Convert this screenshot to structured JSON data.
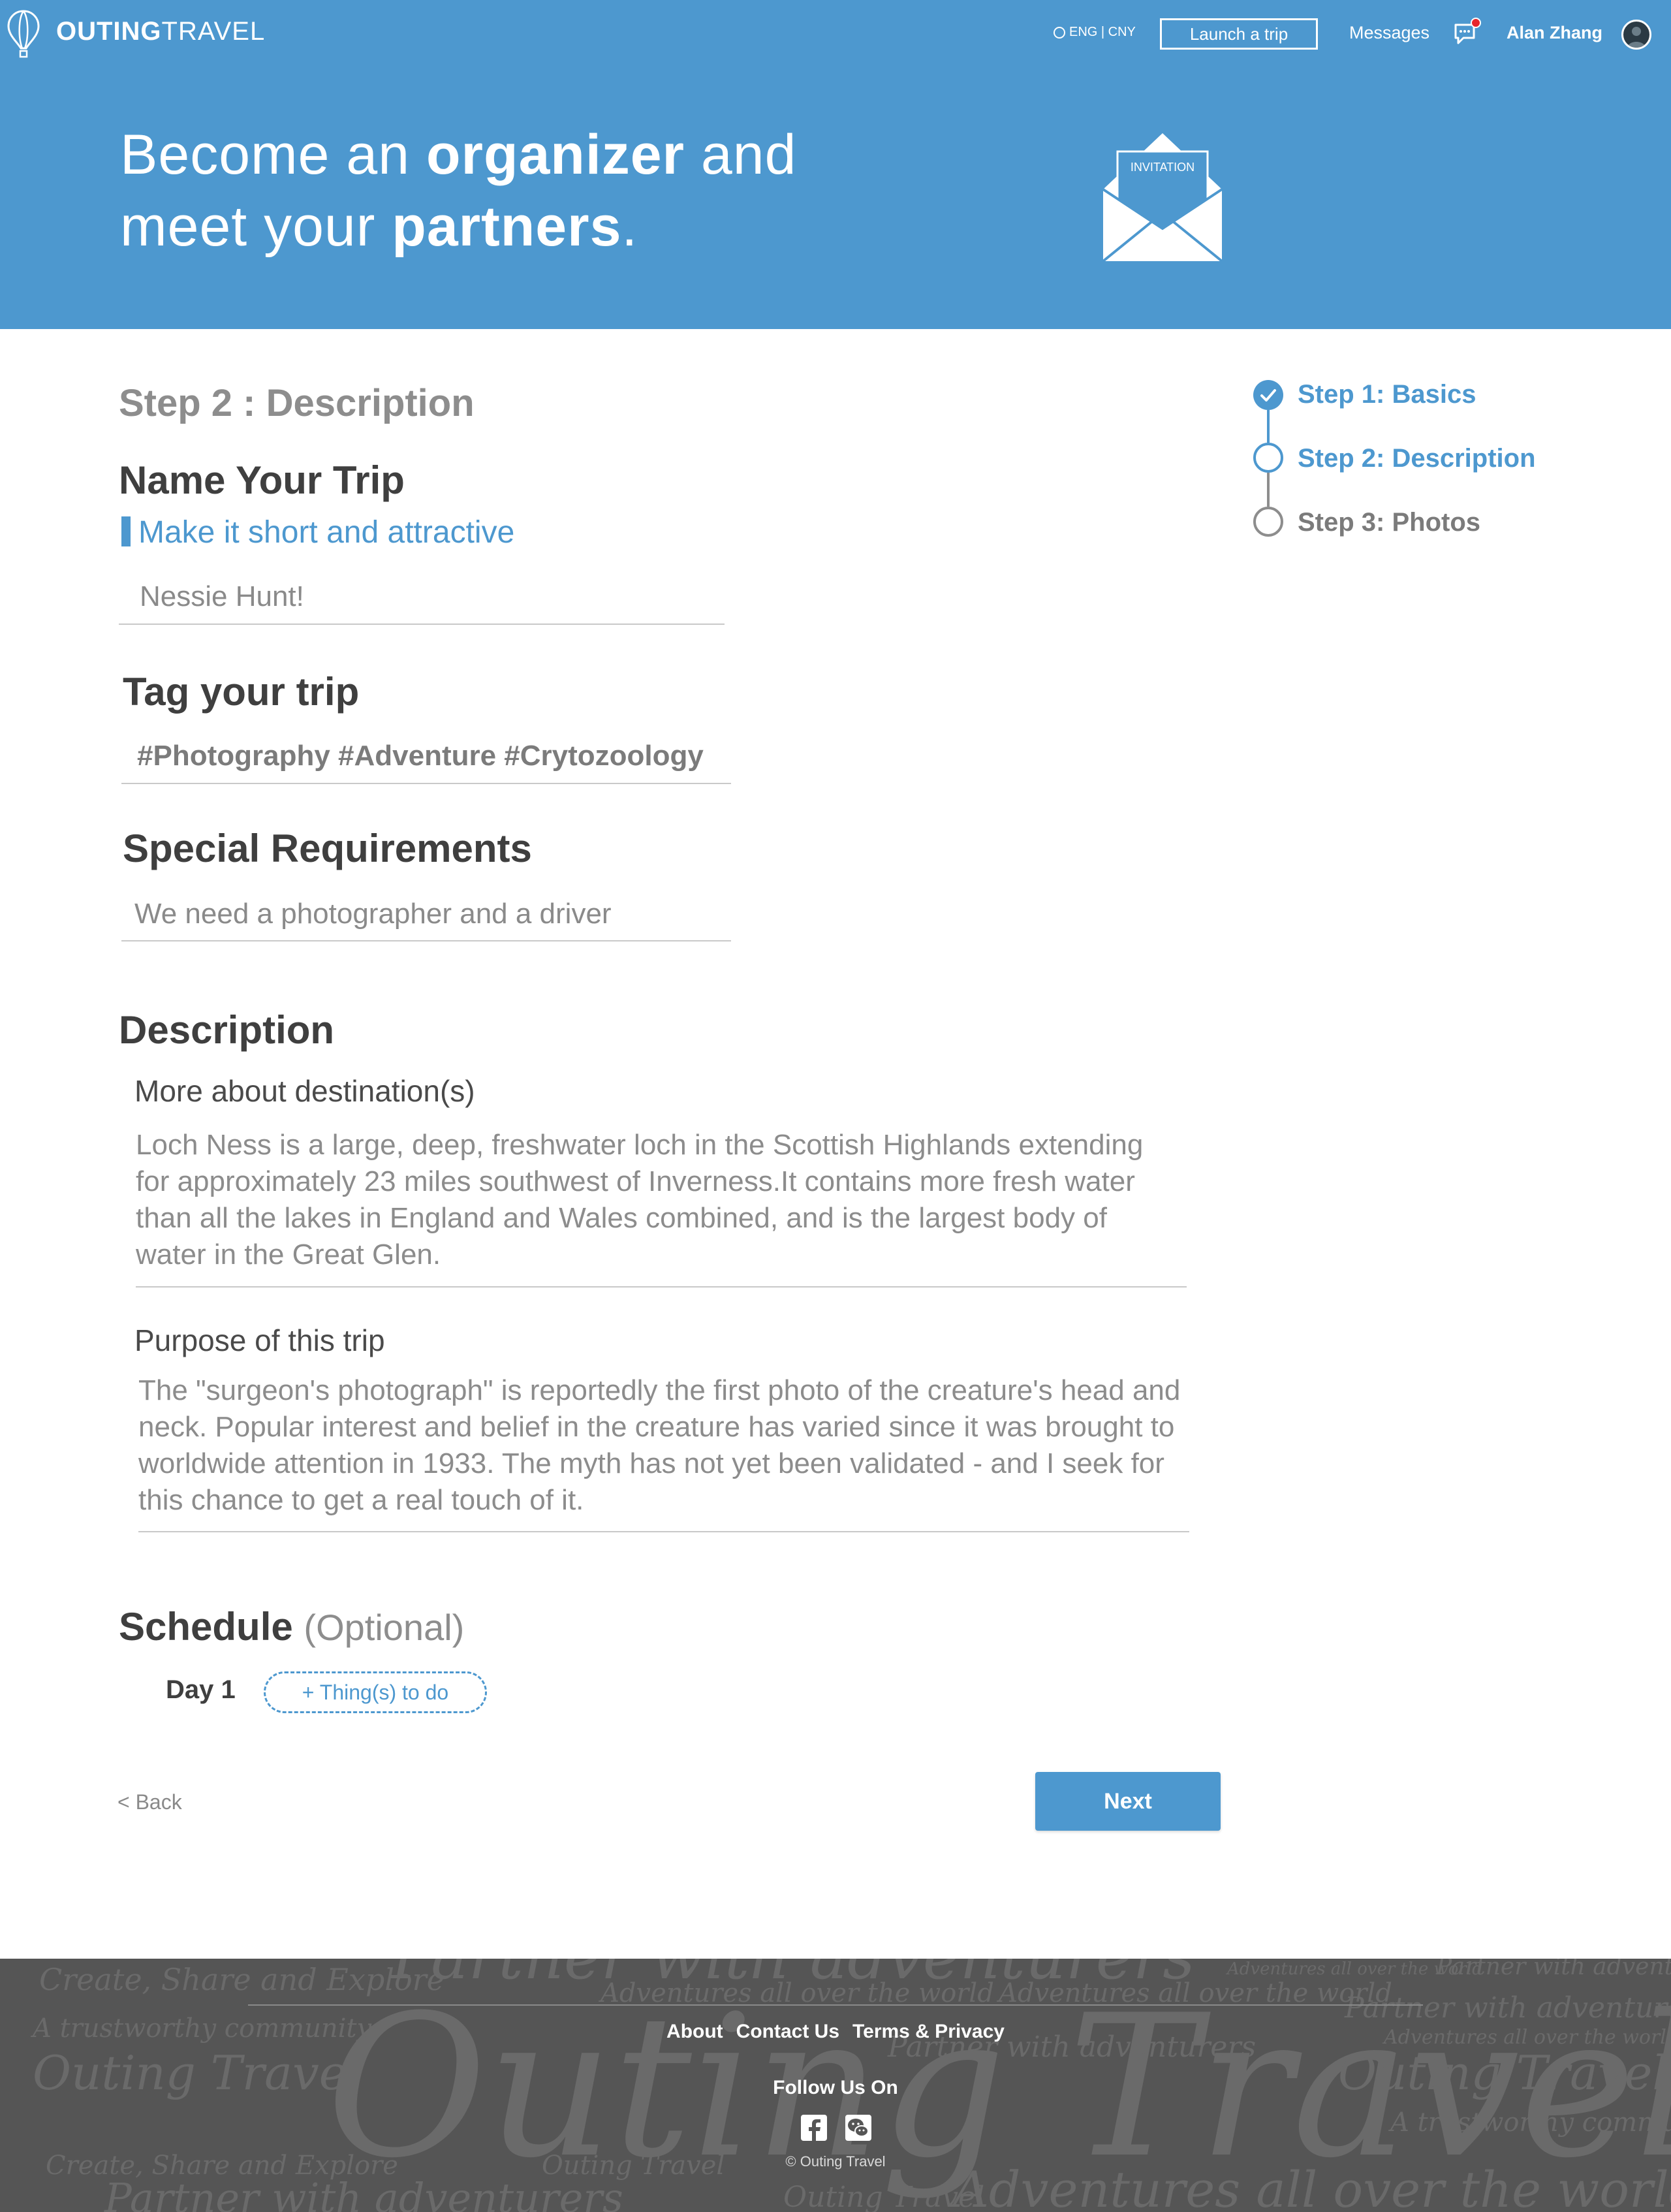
{
  "header": {
    "logo_bold": "OUTING",
    "logo_light": "TRAVEL",
    "language": "ENG | CNY",
    "launch_label": "Launch a trip",
    "messages_label": "Messages",
    "user_name": "Alan Zhang",
    "hero_line1_pre": "Become an ",
    "hero_line1_bold": "organizer",
    "hero_line1_post": " and",
    "hero_line2_pre": "meet your ",
    "hero_line2_bold": "partners",
    "hero_line2_post": ".",
    "envelope_label": "INVITATION",
    "notification_color": "#e8262c"
  },
  "form": {
    "step_title": "Step 2 : Description",
    "name_heading": "Name Your Trip",
    "name_hint": "Make it short and attractive",
    "trip_name": "Nessie Hunt!",
    "tag_heading": "Tag your trip",
    "tags": "#Photography #Adventure #Crytozoology",
    "requirements_heading": "Special Requirements",
    "requirements": "We need a photographer and a driver",
    "description_heading": "Description",
    "destination_heading": "More about destination(s)",
    "destination_text": "Loch Ness is a large, deep, freshwater loch in the Scottish Highlands extending for approximately 23 miles southwest of Inverness.It contains more fresh water than all the lakes in England and Wales combined, and is the largest body of water in the Great Glen.",
    "purpose_heading": "Purpose of this trip",
    "purpose_text": "The \"surgeon's photograph\" is reportedly the first photo of the creature's head and neck. Popular interest and belief in the creature has varied since it was brought to worldwide attention in 1933. The myth has not yet been validated - and I seek for this chance to get a real touch of it.",
    "schedule_heading": "Schedule",
    "schedule_optional": "(Optional)",
    "day_label": "Day 1",
    "add_todo_label": "+ Thing(s) to do",
    "back_label": "< Back",
    "next_label": "Next"
  },
  "stepper": {
    "steps": [
      {
        "label": "Step 1: Basics",
        "state": "completed"
      },
      {
        "label": "Step 2: Description",
        "state": "current"
      },
      {
        "label": "Step 3: Photos",
        "state": "upcoming"
      }
    ]
  },
  "footer": {
    "links": [
      "About",
      "Contact Us",
      "Terms & Privacy"
    ],
    "follow_label": "Follow Us On",
    "social_icons": [
      "facebook-icon",
      "wechat-icon"
    ],
    "copyright": "© Outing Travel",
    "watermark_phrases": [
      "Create, Share and Explore",
      "A trustworthy community",
      "Outing Travel",
      "Partner with adventurers",
      "Adventures all over the world"
    ]
  },
  "colors": {
    "brand_blue": "#4d98cf",
    "footer_bg": "#555555",
    "heading_text": "#3f3f3f",
    "muted_text": "#8c8c8c"
  }
}
